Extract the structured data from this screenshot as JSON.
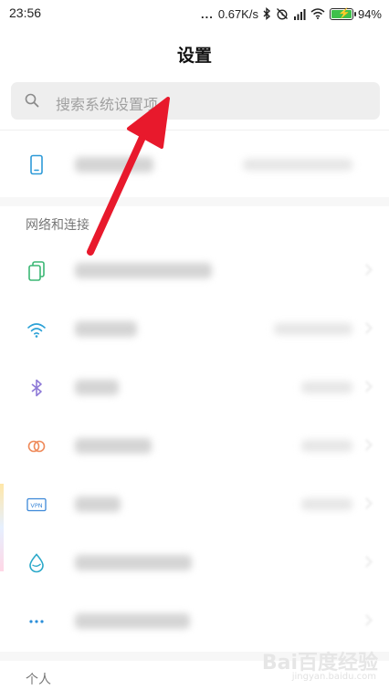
{
  "status_bar": {
    "time": "23:56",
    "dots": "...",
    "speed": "0.67K/s",
    "battery_pct": "94%",
    "battery_color": "#3fc04b"
  },
  "header": {
    "title": "设置"
  },
  "search": {
    "placeholder": "搜索系统设置项",
    "icon": "search-icon"
  },
  "sections": [
    {
      "header": "网络和连接"
    },
    {
      "header": "个人"
    }
  ],
  "rows": [
    {
      "icon": "phone-icon",
      "icon_color": "#2e9ad8"
    },
    {
      "icon": "sim-cards-icon",
      "icon_color": "#3bb774"
    },
    {
      "icon": "wifi-icon",
      "icon_color": "#2ba1d6"
    },
    {
      "icon": "bluetooth-icon",
      "icon_color": "#8e7ad7"
    },
    {
      "icon": "connection-sharing-icon",
      "icon_color": "#ef8a5a"
    },
    {
      "icon": "vpn-icon",
      "icon_color": "#3c88d8"
    },
    {
      "icon": "data-drop-icon",
      "icon_color": "#2aa8c9"
    },
    {
      "icon": "more-icon",
      "icon_color": "#2b8fd9"
    }
  ],
  "annotation": {
    "arrow_color": "#e8192c"
  },
  "watermark": {
    "brand": "Bai百度经验",
    "url": "jingyan.baidu.com"
  }
}
